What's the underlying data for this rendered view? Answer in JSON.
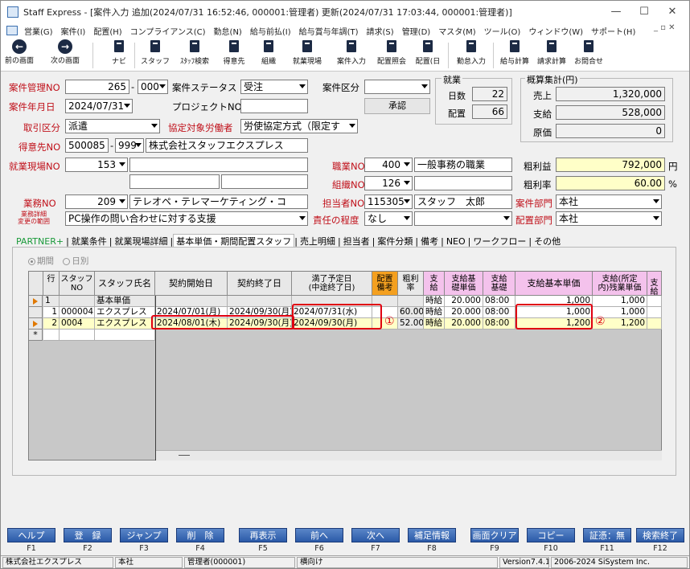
{
  "window": {
    "title": "Staff Express - [案件入力  追加(2024/07/31 16:52:46, 000001:管理者)  更新(2024/07/31 17:03:44, 000001:管理者)]",
    "minimize": "—",
    "maximize": "☐",
    "close": "✕"
  },
  "menu": [
    "営業(G)",
    "案件(I)",
    "配置(H)",
    "コンプライアンス(C)",
    "勤怠(N)",
    "給与前払(I)",
    "給与賞与年調(T)",
    "請求(S)",
    "管理(D)",
    "マスタ(M)",
    "ツール(O)",
    "ウィンドウ(W)",
    "サポート(H)"
  ],
  "mdi_controls": "_ ▫ ✕",
  "toolbar": {
    "prev": "前の画面",
    "next": "次の画面",
    "navi": "ナビ",
    "staff": "スタッフ",
    "staff_search": "ｽﾀｯﾌ検索",
    "client": "得意先",
    "org": "組織",
    "site": "就業現場",
    "case_input": "案件入力",
    "assign_query": "配置照会",
    "assign_day": "配置(日",
    "attendance": "勤怠入力",
    "payroll": "給与計算",
    "billing": "請求計算",
    "contact": "お問合せ"
  },
  "form": {
    "case_no_label": "案件管理NO",
    "case_no": "265",
    "case_no_sub": "000",
    "case_status_label": "案件ステータス",
    "case_status": "受注",
    "case_kind_label": "案件区分",
    "case_kind": "",
    "case_date_label": "案件年月日",
    "case_date": "2024/07/31",
    "project_label": "プロジェクトNO",
    "project": "",
    "approve_btn": "承認",
    "deal_kind_label": "取引区分",
    "deal_kind": "派遣",
    "agreement_label": "協定対象労働者",
    "agreement": "労使協定方式（限定す",
    "client_no_label": "得意先NO",
    "client_no": "500085",
    "client_sub": "999",
    "client_name": "株式会社スタッフエクスプレス",
    "site_no_label": "就業現場NO",
    "site_no": "153",
    "job_no_label": "職業NO",
    "job_no": "400",
    "job_name": "一般事務の職業",
    "org_no_label": "組織NO",
    "org_no": "126",
    "work_no_label": "業務NO",
    "work_no": "209",
    "work_name": "テレオペ・テレマーケティング・コ",
    "work_detail_label1": "業務詳細",
    "work_detail_label2": "変更の範囲",
    "work_detail": "PC操作の問い合わせに対する支援",
    "manager_label": "担当者NO",
    "manager_no": "115305",
    "manager_name": "スタッフ　太郎",
    "resp_label": "責任の程度",
    "resp": "なし",
    "resp2": "",
    "dept_label": "案件部門",
    "dept": "本社",
    "assign_dept_label": "配置部門",
    "assign_dept": "本社"
  },
  "employment": {
    "title": "就業",
    "days_label": "日数",
    "days": "22",
    "assign_label": "配置",
    "assign": "66"
  },
  "summary": {
    "title": "概算集計(円)",
    "sales_label": "売上",
    "sales": "1,320,000",
    "pay_label": "支給",
    "pay": "528,000",
    "cost_label": "原価",
    "cost": "0",
    "gross_label": "粗利益",
    "gross": "792,000",
    "gross_unit": "円",
    "rate_label": "粗利率",
    "rate": "60.00",
    "rate_unit": "%"
  },
  "tabs": [
    "PARTNER+",
    "就業条件",
    "就業現場詳細",
    "基本単価・期間配置スタッフ",
    "売上明細",
    "担当者",
    "案件分類",
    "備考",
    "NEO",
    "ワークフロー",
    "その他"
  ],
  "period": {
    "opt1": "期間",
    "opt2": "日別"
  },
  "grid": {
    "headers": [
      "行",
      "スタッフNO",
      "スタッフ氏名",
      "契約開始日",
      "契約終了日",
      "満了予定日\n(中途終了日)",
      "配置\n備考",
      "粗利\n率",
      "支\n給",
      "支給基\n礎単価",
      "支給\n基礎",
      "支給基本単価",
      "支給(所定\n内)残業単価",
      "支給"
    ],
    "rows": [
      {
        "row": "1",
        "staff_no": "",
        "name": "基本単価",
        "start": "",
        "end": "",
        "expire": "",
        "note": "",
        "rate": "",
        "pay_kind": "時給",
        "base_price": "20.000",
        "base": "08:00",
        "unit": "1,000",
        "overtime": "1,000"
      },
      {
        "row": "1",
        "staff_no": "000004",
        "name": "エクスプレス",
        "start": "2024/07/01(月)",
        "end": "2024/09/30(月)",
        "expire": "2024/07/31(水)",
        "note": "",
        "rate": "60.00",
        "pay_kind": "時給",
        "base_price": "20.000",
        "base": "08:00",
        "unit": "1,000",
        "overtime": "1,000"
      },
      {
        "row": "2",
        "staff_no": "0004",
        "name": "エクスプレス",
        "start": "2024/08/01(木)",
        "end": "2024/09/30(月)",
        "expire": "2024/09/30(月)",
        "note": "",
        "rate": "52.00",
        "pay_kind": "時給",
        "base_price": "20.000",
        "base": "08:00",
        "unit": "1,200",
        "overtime": "1,200"
      }
    ],
    "new_row_mark": "*",
    "marker1": "①",
    "marker2": "②"
  },
  "fkeys": [
    {
      "label": "ヘルプ",
      "key": "F1"
    },
    {
      "label": "登　録",
      "key": "F2"
    },
    {
      "label": "ジャンプ",
      "key": "F3"
    },
    {
      "label": "削　除",
      "key": "F4"
    },
    {
      "label": "再表示",
      "key": "F5"
    },
    {
      "label": "前へ",
      "key": "F6"
    },
    {
      "label": "次へ",
      "key": "F7"
    },
    {
      "label": "補足情報",
      "key": "F8"
    },
    {
      "label": "画面クリア",
      "key": "F9"
    },
    {
      "label": "コピー",
      "key": "F10"
    },
    {
      "label": "証憑：無",
      "key": "F11"
    },
    {
      "label": "検索終了",
      "key": "F12"
    }
  ],
  "status": {
    "company": "株式会社エクスプレス",
    "branch": "本社",
    "user": "管理者(000001)",
    "mode": "横向け",
    "version": "Version7.4.19",
    "copyright": "2006-2024 SiSystem Inc."
  }
}
